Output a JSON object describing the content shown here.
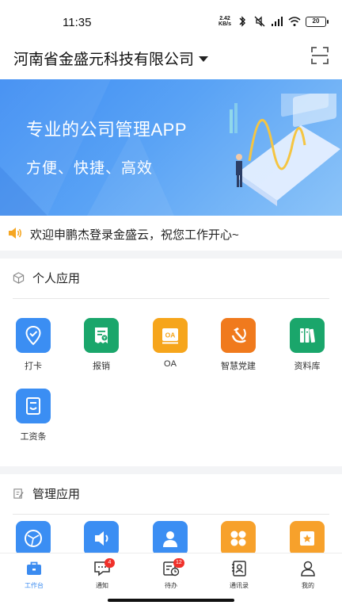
{
  "status_bar": {
    "time": "11:35",
    "net_speed_value": "2.42",
    "net_speed_unit": "KB/s",
    "battery": "20"
  },
  "header": {
    "company_name": "河南省金盛元科技有限公司",
    "scan_icon": "scan-icon"
  },
  "banner": {
    "title": "专业的公司管理APP",
    "subtitle": "方便、快捷、高效"
  },
  "notice": {
    "text": "欢迎申鹏杰登录金盛云，祝您工作开心~"
  },
  "personal_apps": {
    "title": "个人应用",
    "items": [
      {
        "label": "打卡",
        "icon": "location-check-icon",
        "color": "#3b8ef3"
      },
      {
        "label": "报销",
        "icon": "receipt-icon",
        "color": "#1aa66b"
      },
      {
        "label": "OA",
        "icon": "oa-icon",
        "color": "#f6a51b"
      },
      {
        "label": "智慧党建",
        "icon": "party-emblem-icon",
        "color": "#f07a1d"
      },
      {
        "label": "资料库",
        "icon": "books-icon",
        "color": "#1aa66b"
      },
      {
        "label": "工资条",
        "icon": "payslip-icon",
        "color": "#3b8ef3"
      }
    ]
  },
  "manage_apps": {
    "title": "管理应用",
    "items": [
      {
        "icon": "globe-network-icon",
        "color": "#3b8ef3"
      },
      {
        "icon": "speaker-icon",
        "color": "#3b8ef3"
      },
      {
        "icon": "person-icon",
        "color": "#3b8ef3"
      },
      {
        "icon": "grid-icon",
        "color": "#f7a12b"
      },
      {
        "icon": "star-box-icon",
        "color": "#f7a12b"
      }
    ]
  },
  "tabs": [
    {
      "label": "工作台",
      "icon": "briefcase-icon",
      "active": true
    },
    {
      "label": "通知",
      "icon": "message-icon",
      "badge": "4"
    },
    {
      "label": "待办",
      "icon": "todo-clock-icon",
      "badge": "12"
    },
    {
      "label": "通讯录",
      "icon": "contacts-icon"
    },
    {
      "label": "我的",
      "icon": "profile-icon"
    }
  ],
  "colors": {
    "accent": "#3b8bf0",
    "badge": "#f0302a"
  }
}
